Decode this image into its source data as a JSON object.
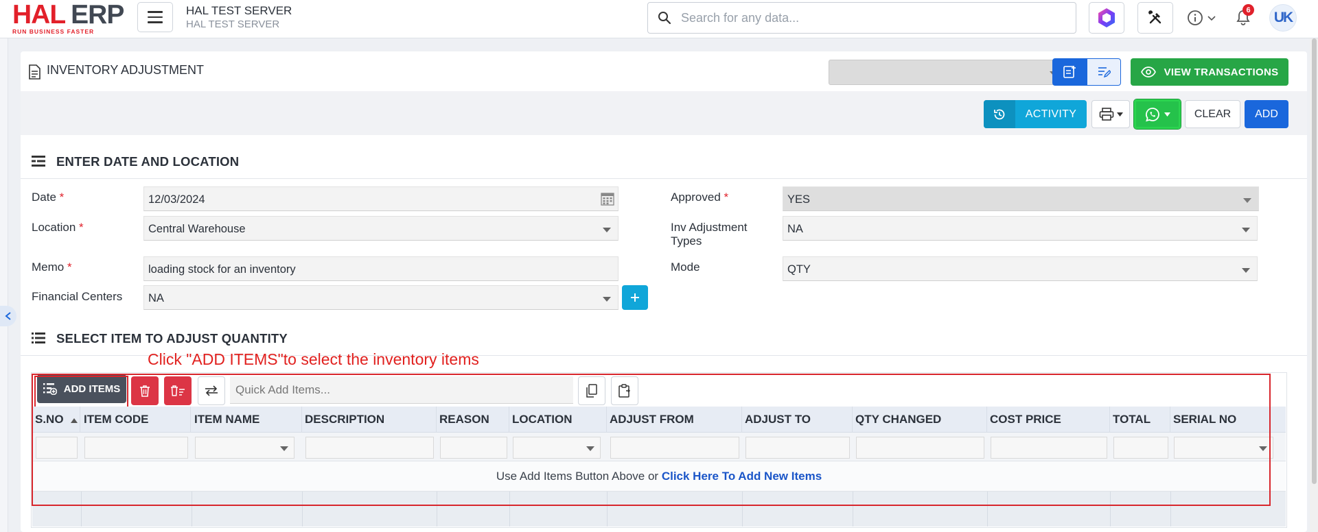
{
  "brand": {
    "logo_main_a": "HAL",
    "logo_main_b": "ERP",
    "logo_tagline": "RUN BUSINESS FASTER",
    "accent": "#e2202a"
  },
  "header": {
    "server_name": "HAL TEST SERVER",
    "server_sub": "HAL TEST SERVER",
    "search_placeholder": "Search for any data...",
    "notifications_count": "6",
    "avatar_initials": "UK",
    "icons": [
      "menu-icon",
      "search-icon",
      "app-launcher-icon",
      "tools-icon",
      "info-icon",
      "chevron-down-icon",
      "bell-icon"
    ]
  },
  "page": {
    "title": "INVENTORY ADJUSTMENT",
    "view_transactions_label": "VIEW TRANSACTIONS",
    "activity_label": "ACTIVITY",
    "clear_label": "CLEAR",
    "add_label": "ADD"
  },
  "section1": {
    "title": "ENTER DATE AND LOCATION",
    "fields": {
      "date": {
        "label": "Date",
        "required": "*",
        "value": "12/03/2024"
      },
      "location": {
        "label": "Location",
        "required": "*",
        "value": "Central Warehouse"
      },
      "memo": {
        "label": "Memo",
        "required": "*",
        "value": "loading stock for an inventory"
      },
      "financial_centers": {
        "label": "Financial Centers",
        "value": "NA"
      },
      "approved": {
        "label": "Approved",
        "required": "*",
        "value": "YES"
      },
      "inv_adjustment_types": {
        "label_line1": "Inv Adjustment",
        "label_line2": "Types",
        "value": "NA"
      },
      "mode": {
        "label": "Mode",
        "value": "QTY"
      }
    }
  },
  "section2": {
    "title": "SELECT ITEM TO ADJUST QUANTITY",
    "annotation": "Click \"ADD ITEMS\"to select the inventory items",
    "add_items_label": "ADD ITEMS",
    "quick_add_placeholder": "Quick Add Items...",
    "columns": [
      "S.NO",
      "ITEM CODE",
      "ITEM NAME",
      "DESCRIPTION",
      "REASON",
      "LOCATION",
      "ADJUST FROM",
      "ADJUST TO",
      "QTY CHANGED",
      "COST PRICE",
      "TOTAL",
      "SERIAL NO"
    ],
    "empty_text": "Use Add Items Button Above or ",
    "empty_link": "Click Here To Add New Items"
  },
  "colors": {
    "primary": "#1a67dc",
    "success": "#27a646",
    "info": "#10a6d9",
    "danger": "#dc3545",
    "whatsapp": "#25c24b"
  }
}
